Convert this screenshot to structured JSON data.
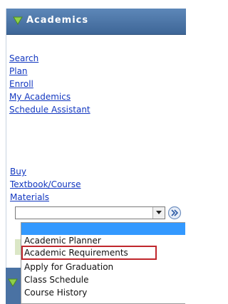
{
  "header": {
    "title": "Academics",
    "expanded_icon": "triangle-down-icon",
    "bg_color": "#4a72a3"
  },
  "links_group1": [
    {
      "label": "Search"
    },
    {
      "label": "Plan"
    },
    {
      "label": "Enroll"
    },
    {
      "label": "My Academics"
    },
    {
      "label": "Schedule Assistant"
    }
  ],
  "links_group2": [
    {
      "label": "Buy"
    },
    {
      "label": "Textbook/Course"
    },
    {
      "label": "Materials"
    }
  ],
  "select": {
    "selected_value": "",
    "go_icon": "double-chevron-right-icon"
  },
  "dropdown": {
    "options": [
      {
        "label": ""
      },
      {
        "label": "Academic Planner"
      },
      {
        "label": "Academic Requirements"
      },
      {
        "label": "Apply for Graduation"
      },
      {
        "label": "Class Schedule"
      },
      {
        "label": "Course History"
      }
    ],
    "highlighted_option": "Academic Requirements",
    "highlight_color": "#c0262c",
    "selected_color": "#3399ff"
  },
  "link_color": "#1237c0"
}
